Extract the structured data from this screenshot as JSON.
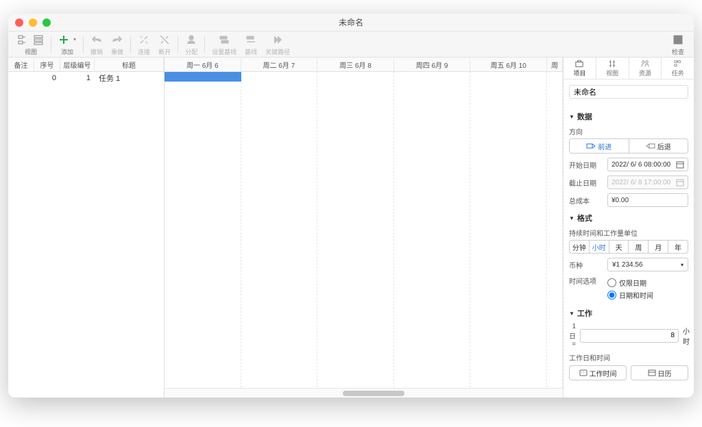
{
  "window": {
    "title": "未命名"
  },
  "toolbar": {
    "view": "视图",
    "add": "添加",
    "undo": "撤销",
    "redo": "重做",
    "link": "连接",
    "unlink": "断开",
    "assign": "分配",
    "set_baseline": "设置基线",
    "baseline": "基线",
    "critical_path": "关键路径",
    "inspector": "检查"
  },
  "columns": {
    "notes": "备注",
    "index": "序号",
    "outline": "层级编号",
    "title": "标题"
  },
  "task": {
    "index": "0",
    "outline": "1",
    "title": "任务 1"
  },
  "days": [
    "周一 6月 6",
    "周二 6月 7",
    "周三 6月 8",
    "周四 6月 9",
    "周五 6月 10",
    "周"
  ],
  "inspector": {
    "tabs": {
      "project": "项目",
      "view": "视图",
      "resources": "资源",
      "task": "任务"
    },
    "project_name": "未命名",
    "sections": {
      "data": "数据",
      "format": "格式",
      "work": "工作"
    },
    "direction": {
      "label": "方向",
      "forward": "前进",
      "backward": "后退"
    },
    "start_date": {
      "label": "开始日期",
      "value": "2022/ 6/  6 08:00:00"
    },
    "end_date": {
      "label": "截止日期",
      "value": "2022/ 6/  8 17:00:00"
    },
    "total_cost": {
      "label": "总成本",
      "value": "¥0.00"
    },
    "duration_label": "持续时间和工作量单位",
    "units": {
      "min": "分钟",
      "hour": "小时",
      "day": "天",
      "week": "周",
      "month": "月",
      "year": "年"
    },
    "currency": {
      "label": "币种",
      "value": "¥1 234.56"
    },
    "time_option": {
      "label": "时间选项",
      "date_only": "仅限日期",
      "date_time": "日期和时间"
    },
    "work": {
      "one_day_equals": "1 日 =",
      "value": "8",
      "hours": "小时"
    },
    "work_days_time": "工作日和时间",
    "work_time_btn": "工作时间",
    "calendar_btn": "日历"
  }
}
